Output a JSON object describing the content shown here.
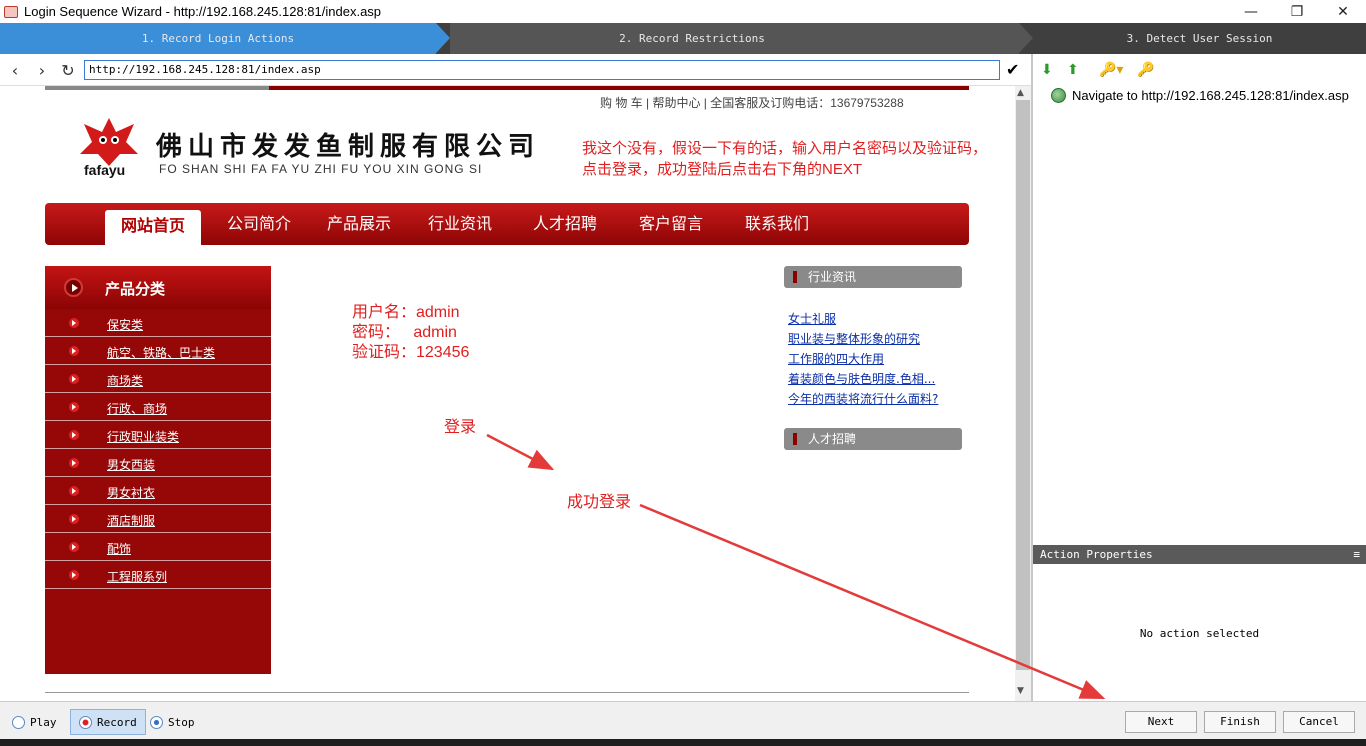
{
  "window": {
    "title": "Login Sequence Wizard - http://192.168.245.128:81/index.asp",
    "controls": [
      "—",
      "❐",
      "✕"
    ]
  },
  "steps": [
    {
      "label": "1. Record Login Actions"
    },
    {
      "label": "2. Record Restrictions"
    },
    {
      "label": "3. Detect User Session"
    }
  ],
  "browser": {
    "url": "http://192.168.245.128:81/index.asp"
  },
  "webpage": {
    "top_links": "购 物 车 | 帮助中心 | 全国客服及订购电话：13679753288",
    "logo_text": "fafayu",
    "company_cn": "佛山市发发鱼制服有限公司",
    "company_en": "FO SHAN SHI FA FA YU ZHI FU YOU XIN GONG SI",
    "nav": [
      "网站首页",
      "公司简介",
      "产品展示",
      "行业资讯",
      "人才招聘",
      "客户留言",
      "联系我们"
    ],
    "sidebar_title": "产品分类",
    "categories": [
      "保安类",
      "航空、铁路、巴士类",
      "商场类",
      "行政、商场",
      "行政职业装类",
      "男女西装",
      "男女衬衣",
      "酒店制服",
      "配饰",
      "工程服系列"
    ],
    "news_title": "行业资讯",
    "news": [
      "女士礼服",
      "职业装与整体形象的研究",
      "工作服的四大作用",
      "着装颜色与肤色明度.色相...",
      "今年的西装将流行什么面料?"
    ],
    "jobs_title": "人才招聘",
    "annotations": {
      "note_line1": "我这个没有，假设一下有的话，输入用户名密码以及验证码，",
      "note_line2": "点击登录，成功登陆后点击右下角的NEXT",
      "username": "用户名：admin",
      "password": "密码：   admin",
      "captcha": "验证码：123456",
      "login": "登录",
      "success": "成功登录"
    }
  },
  "actions": {
    "items": [
      "Navigate to http://192.168.245.128:81/index.asp"
    ]
  },
  "properties": {
    "title": "Action Properties",
    "menu_icon": "≡",
    "empty_message": "No action selected"
  },
  "controls": {
    "play": "Play",
    "record": "Record",
    "stop": "Stop",
    "next": "Next",
    "finish": "Finish",
    "cancel": "Cancel"
  },
  "colors": {
    "step_active": "#3b8ed8",
    "site_red": "#960808",
    "annotation": "#e02020"
  }
}
